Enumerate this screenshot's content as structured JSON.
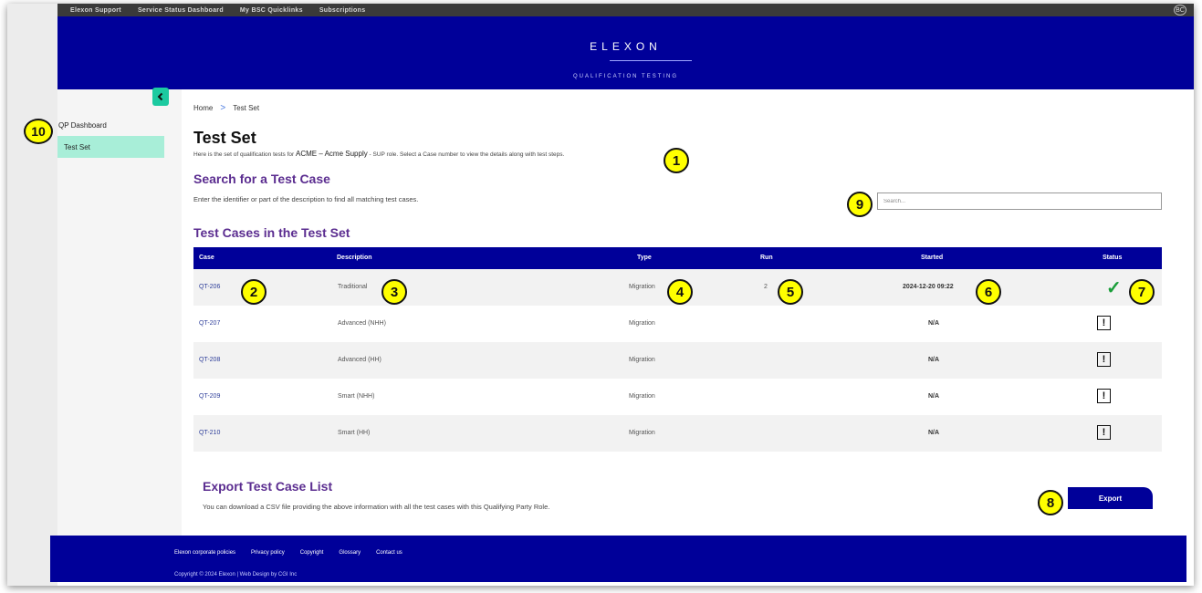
{
  "utility_nav": [
    "Elexon Support",
    "Service Status Dashboard",
    "My BSC Quicklinks",
    "Subscriptions"
  ],
  "user_initials": "BC",
  "brand": {
    "name": "ELEXON",
    "subtitle": "QUALIFICATION TESTING"
  },
  "sidebar": {
    "items": [
      {
        "label": "QP Dashboard"
      },
      {
        "label": "Test Set"
      }
    ]
  },
  "breadcrumb": {
    "home": "Home",
    "separator": ">",
    "current": "Test Set"
  },
  "page": {
    "title": "Test Set",
    "intro_before": "Here is the set of qualification tests for",
    "party": "ACME – Acme Supply",
    "intro_after": "- SUP role. Select a Case number to view the details along with test steps."
  },
  "search": {
    "heading": "Search for a Test Case",
    "description": "Enter the identifier or part of the description to find all matching test cases.",
    "placeholder": "Search..."
  },
  "test_cases": {
    "heading": "Test Cases in the Test Set",
    "columns": {
      "case": "Case",
      "description": "Description",
      "type": "Type",
      "run": "Run",
      "started": "Started",
      "status": "Status"
    },
    "rows": [
      {
        "case": "QT-206",
        "description": "Traditional",
        "type": "Migration",
        "run": "2",
        "started": "2024-12-20 09:22",
        "status": "passed",
        "status_symbol": "✓"
      },
      {
        "case": "QT-207",
        "description": "Advanced (NHH)",
        "type": "Migration",
        "run": "",
        "started": "N/A",
        "status": "not-started",
        "status_symbol": "!"
      },
      {
        "case": "QT-208",
        "description": "Advanced (HH)",
        "type": "Migration",
        "run": "",
        "started": "N/A",
        "status": "not-started",
        "status_symbol": "!"
      },
      {
        "case": "QT-209",
        "description": "Smart (NHH)",
        "type": "Migration",
        "run": "",
        "started": "N/A",
        "status": "not-started",
        "status_symbol": "!"
      },
      {
        "case": "QT-210",
        "description": "Smart (HH)",
        "type": "Migration",
        "run": "",
        "started": "N/A",
        "status": "not-started",
        "status_symbol": "!"
      }
    ]
  },
  "export": {
    "heading": "Export Test Case List",
    "description": "You can download a CSV file providing the above information with all the test cases with this Qualifying Party Role.",
    "button_label": "Export"
  },
  "footer": {
    "links": [
      "Elexon corporate policies",
      "Privacy policy",
      "Copyright",
      "Glossary",
      "Contact us"
    ],
    "copyright": "Copyright © 2024 Elexon  |  Web Design by CGI Inc"
  },
  "callouts": [
    "1",
    "2",
    "3",
    "4",
    "5",
    "6",
    "7",
    "8",
    "9",
    "10"
  ],
  "colors": {
    "brand_blue": "#000099",
    "accent_purple": "#5b2d90",
    "active_nav": "#a8eed8",
    "toggle_green": "#1ccaa0",
    "pass_green": "#1a9e3a",
    "callout_yellow": "#ffff00"
  }
}
